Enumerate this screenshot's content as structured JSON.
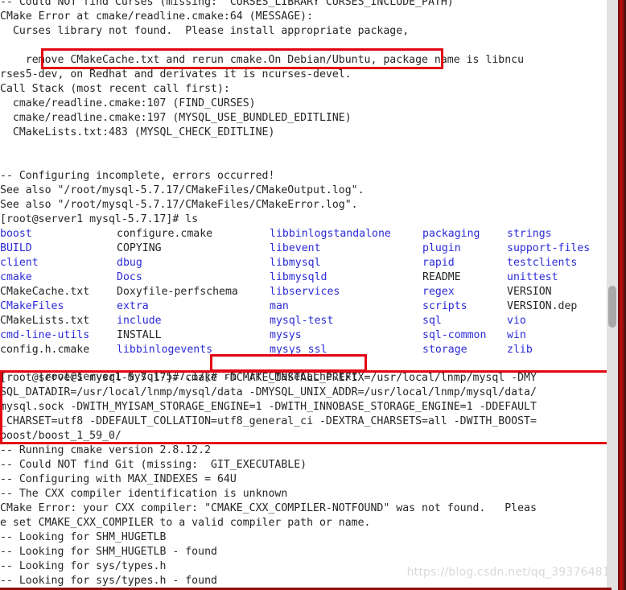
{
  "terminal": {
    "prompt": "[root@server1 mysql-5.7.17]# ",
    "colors": {
      "foreground": "#262626",
      "background": "#ffffff",
      "directory_blue": "#2b2bd8",
      "annotation_red": "#e30613",
      "scrollbar_track": "#e2e2e2",
      "scrollbar_thumb": "#a8a8a8"
    },
    "lines": [
      "-- Could NOT find Curses (missing:  CURSES_LIBRARY CURSES_INCLUDE_PATH)",
      "CMake Error at cmake/readline.cmake:64 (MESSAGE):",
      "  Curses library not found.  Please install appropriate package,",
      "",
      "    remove CMakeCache.txt and rerun cmake.On Debian/Ubuntu, package name is libncu",
      "rses5-dev, on Redhat and derivates it is ncurses-devel.",
      "Call Stack (most recent call first):",
      "  cmake/readline.cmake:107 (FIND_CURSES)",
      "  cmake/readline.cmake:197 (MYSQL_USE_BUNDLED_EDITLINE)",
      "  CMakeLists.txt:483 (MYSQL_CHECK_EDITLINE)",
      "",
      "",
      "-- Configuring incomplete, errors occurred!",
      "See also \"/root/mysql-5.7.17/CMakeFiles/CMakeOutput.log\".",
      "See also \"/root/mysql-5.7.17/CMakeFiles/CMakeError.log\".",
      "[root@server1 mysql-5.7.17]# ls"
    ],
    "ls_command": "ls",
    "ls_output": {
      "columns": [
        [
          {
            "name": "boost",
            "type": "dir"
          },
          {
            "name": "BUILD",
            "type": "dir"
          },
          {
            "name": "client",
            "type": "dir"
          },
          {
            "name": "cmake",
            "type": "dir"
          },
          {
            "name": "CMakeCache.txt",
            "type": "file"
          },
          {
            "name": "CMakeFiles",
            "type": "dir"
          },
          {
            "name": "CMakeLists.txt",
            "type": "file"
          },
          {
            "name": "cmd-line-utils",
            "type": "dir"
          },
          {
            "name": "config.h.cmake",
            "type": "file"
          }
        ],
        [
          {
            "name": "configure.cmake",
            "type": "file"
          },
          {
            "name": "COPYING",
            "type": "file"
          },
          {
            "name": "dbug",
            "type": "dir"
          },
          {
            "name": "Docs",
            "type": "dir"
          },
          {
            "name": "Doxyfile-perfschema",
            "type": "file"
          },
          {
            "name": "extra",
            "type": "dir"
          },
          {
            "name": "include",
            "type": "dir"
          },
          {
            "name": "INSTALL",
            "type": "file"
          },
          {
            "name": "libbinlogevents",
            "type": "dir"
          }
        ],
        [
          {
            "name": "libbinlogstandalone",
            "type": "dir"
          },
          {
            "name": "libevent",
            "type": "dir"
          },
          {
            "name": "libmysql",
            "type": "dir"
          },
          {
            "name": "libmysqld",
            "type": "dir"
          },
          {
            "name": "libservices",
            "type": "dir"
          },
          {
            "name": "man",
            "type": "dir"
          },
          {
            "name": "mysql-test",
            "type": "dir"
          },
          {
            "name": "mysys",
            "type": "dir"
          },
          {
            "name": "mysys_ssl",
            "type": "dir"
          }
        ],
        [
          {
            "name": "packaging",
            "type": "dir"
          },
          {
            "name": "plugin",
            "type": "dir"
          },
          {
            "name": "rapid",
            "type": "dir"
          },
          {
            "name": "README",
            "type": "file"
          },
          {
            "name": "regex",
            "type": "dir"
          },
          {
            "name": "scripts",
            "type": "dir"
          },
          {
            "name": "sql",
            "type": "dir"
          },
          {
            "name": "sql-common",
            "type": "dir"
          },
          {
            "name": "storage",
            "type": "dir"
          }
        ],
        [
          {
            "name": "strings",
            "type": "dir"
          },
          {
            "name": "support-files",
            "type": "dir"
          },
          {
            "name": "testclients",
            "type": "dir"
          },
          {
            "name": "unittest",
            "type": "dir"
          },
          {
            "name": "VERSION",
            "type": "file"
          },
          {
            "name": "VERSION.dep",
            "type": "file"
          },
          {
            "name": "vio",
            "type": "dir"
          },
          {
            "name": "win",
            "type": "dir"
          },
          {
            "name": "zlib",
            "type": "dir"
          }
        ]
      ]
    },
    "rm_line": {
      "prompt": "[root@server1 mysql-5.7.17]# ",
      "command": "rm -rf CMakeCache.txt"
    },
    "cmake_block": [
      "[root@server1 mysql-5.7.17]# cmake -DCMAKE_INSTALL_PREFIX=/usr/local/lnmp/mysql -DMY",
      "SQL_DATADIR=/usr/local/lnmp/mysql/data -DMYSQL_UNIX_ADDR=/usr/local/lnmp/mysql/data/",
      "mysql.sock -DWITH_MYISAM_STORAGE_ENGINE=1 -DWITH_INNOBASE_STORAGE_ENGINE=1 -DDEFAULT",
      "_CHARSET=utf8 -DDEFAULT_COLLATION=utf8_general_ci -DEXTRA_CHARSETS=all -DWITH_BOOST=",
      "boost/boost_1_59_0/"
    ],
    "tail_lines": [
      "-- Running cmake version 2.8.12.2",
      "-- Could NOT find Git (missing:  GIT_EXECUTABLE)",
      "-- Configuring with MAX_INDEXES = 64U",
      "-- The CXX compiler identification is unknown",
      "CMake Error: your CXX compiler: \"CMAKE_CXX_COMPILER-NOTFOUND\" was not found.   Pleas",
      "e set CMAKE_CXX_COMPILER to a valid compiler path or name.",
      "-- Looking for SHM_HUGETLB",
      "-- Looking for SHM_HUGETLB - found",
      "-- Looking for sys/types.h",
      "-- Looking for sys/types.h - found"
    ]
  },
  "annotations": {
    "box_remove_hint": "remove CMakeCache.txt and rerun cmake.On Debian/Ubuntu,",
    "box_rm_command": "rm -rf CMakeCache.txt",
    "box_cmake_command": "cmake configure command block"
  },
  "watermark": {
    "text": "https://blog.csdn.net/qq_39376481"
  }
}
